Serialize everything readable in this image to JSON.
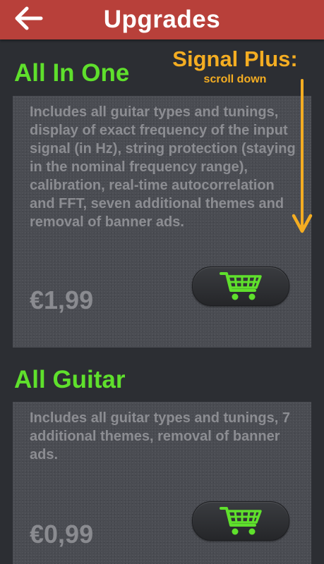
{
  "header": {
    "title": "Upgrades",
    "back_icon": "arrow-left-icon",
    "color": "#b8403a"
  },
  "annotation": {
    "title": "Signal Plus:",
    "subtitle": "scroll down",
    "color": "#f4ad22",
    "arrow_icon": "arrow-down-icon"
  },
  "products": [
    {
      "title": "All In One",
      "description": "Includes all guitar types and tunings, display of exact frequency of the input signal (in Hz), string protection (staying in the nominal frequency range), calibration, real-time autocorrelation and FFT, seven additional themes and removal of banner ads.",
      "price": "€1,99",
      "cart_icon": "shopping-cart-icon"
    },
    {
      "title": "All Guitar",
      "description": "Includes all guitar types and tunings, 7 additional themes, removal of banner ads.",
      "price": "€0,99",
      "cart_icon": "shopping-cart-icon"
    }
  ],
  "colors": {
    "accent_green": "#5fe02c",
    "background": "#2c2e33",
    "card": "#4a4c52"
  }
}
